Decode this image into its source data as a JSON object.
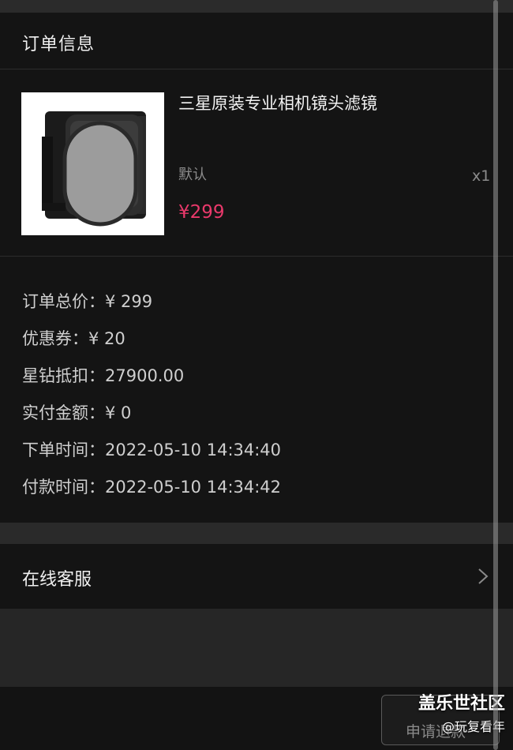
{
  "order": {
    "title": "订单信息",
    "product": {
      "name": "三星原装专业相机镜头滤镜",
      "variant": "默认",
      "quantity": "x1",
      "price": "¥299"
    },
    "details": [
      {
        "label": "订单总价：",
        "value": "¥ 299"
      },
      {
        "label": "优惠券：",
        "value": "¥ 20"
      },
      {
        "label": "星钻抵扣：",
        "value": "27900.00"
      },
      {
        "label": "实付金额：",
        "value": "¥ 0"
      },
      {
        "label": "下单时间：",
        "value": "2022-05-10 14:34:40"
      },
      {
        "label": "付款时间：",
        "value": "2022-05-10 14:34:42"
      }
    ]
  },
  "service": {
    "label": "在线客服",
    "icon": "chevron-right-icon"
  },
  "bottom_bar": {
    "refund_label": "申请退款"
  },
  "watermark": {
    "brand": "盖乐世社区",
    "user": "@玩复看年"
  },
  "colors": {
    "price": "#e9396b",
    "card_bg": "#141414",
    "page_bg": "#262626"
  }
}
